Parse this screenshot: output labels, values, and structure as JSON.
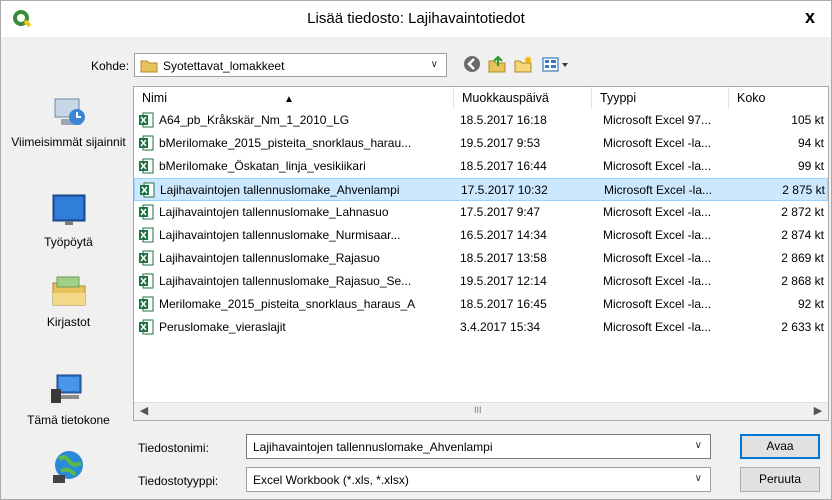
{
  "window": {
    "title": "Lisää tiedosto: Lajihavaintotiedot",
    "close_glyph": "x",
    "app_icon": "qgis-icon"
  },
  "lookin": {
    "label": "Kohde:",
    "value": "Syotettavat_lomakkeet"
  },
  "places": [
    {
      "label": "Viimeisimmät sijainnit",
      "icon": "recent-places-icon"
    },
    {
      "label": "Työpöytä",
      "icon": "desktop-icon"
    },
    {
      "label": "Kirjastot",
      "icon": "libraries-icon"
    },
    {
      "label": "Tämä tietokone",
      "icon": "computer-icon"
    },
    {
      "label": "",
      "icon": "network-icon"
    }
  ],
  "columns": {
    "name": "Nimi",
    "date": "Muokkauspäivä",
    "type": "Tyyppi",
    "size": "Koko"
  },
  "files": [
    {
      "name": "A64_pb_Kråkskär_Nm_1_2010_LG",
      "date": "18.5.2017 16:18",
      "type": "Microsoft Excel 97...",
      "size": "105 kt"
    },
    {
      "name": "bMerilomake_2015_pisteita_snorklaus_harau...",
      "date": "19.5.2017 9:53",
      "type": "Microsoft Excel -la...",
      "size": "94 kt"
    },
    {
      "name": "bMerilomake_Öskatan_linja_vesikiikari",
      "date": "18.5.2017 16:44",
      "type": "Microsoft Excel -la...",
      "size": "99 kt"
    },
    {
      "name": "Lajihavaintojen tallennuslomake_Ahvenlampi",
      "date": "17.5.2017 10:32",
      "type": "Microsoft Excel -la...",
      "size": "2 875 kt"
    },
    {
      "name": "Lajihavaintojen tallennuslomake_Lahnasuo",
      "date": "17.5.2017 9:47",
      "type": "Microsoft Excel -la...",
      "size": "2 872 kt"
    },
    {
      "name": "Lajihavaintojen tallennuslomake_Nurmisaar...",
      "date": "16.5.2017 14:34",
      "type": "Microsoft Excel -la...",
      "size": "2 874 kt"
    },
    {
      "name": "Lajihavaintojen tallennuslomake_Rajasuo",
      "date": "18.5.2017 13:58",
      "type": "Microsoft Excel -la...",
      "size": "2 869 kt"
    },
    {
      "name": "Lajihavaintojen tallennuslomake_Rajasuo_Se...",
      "date": "19.5.2017 12:14",
      "type": "Microsoft Excel -la...",
      "size": "2 868 kt"
    },
    {
      "name": "Merilomake_2015_pisteita_snorklaus_haraus_A",
      "date": "18.5.2017 16:45",
      "type": "Microsoft Excel -la...",
      "size": "92 kt"
    },
    {
      "name": "Peruslomake_vieraslajit",
      "date": "3.4.2017 15:34",
      "type": "Microsoft Excel -la...",
      "size": "2 633 kt"
    }
  ],
  "selected_index": 3,
  "scrollbar": {
    "grip": "III"
  },
  "filename": {
    "label": "Tiedostonimi:",
    "value": "Lajihavaintojen tallennuslomake_Ahvenlampi"
  },
  "filetype": {
    "label": "Tiedostotyyppi:",
    "value": "Excel Workbook (*.xls, *.xlsx)"
  },
  "buttons": {
    "open": "Avaa",
    "cancel": "Peruuta"
  },
  "colors": {
    "selection": "#cce8ff",
    "default_button_border": "#0078d7",
    "excel_green": "#1d7044"
  }
}
